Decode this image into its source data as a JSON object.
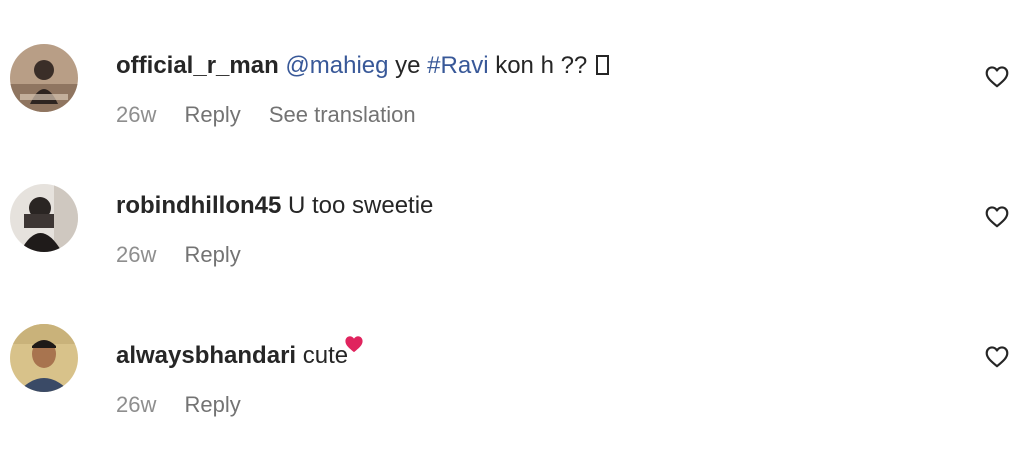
{
  "comments": [
    {
      "username": "official_r_man",
      "mention": "@mahieg",
      "pre_hashtag": " ye ",
      "hashtag": "#Ravi",
      "post_hashtag": " kon h ?? ",
      "timestamp": "26w",
      "reply_label": "Reply",
      "translation_label": "See translation",
      "avatar_icon": "avatar-photo",
      "like_icon": "heart-outline-icon"
    },
    {
      "username": "robindhillon45",
      "text": " U too sweetie",
      "timestamp": "26w",
      "reply_label": "Reply",
      "avatar_icon": "avatar-photo",
      "like_icon": "heart-outline-icon"
    },
    {
      "username": "alwaysbhandari",
      "text": " cute",
      "emoji": "red-heart",
      "timestamp": "26w",
      "reply_label": "Reply",
      "avatar_icon": "avatar-photo",
      "like_icon": "heart-outline-icon"
    }
  ],
  "colors": {
    "text": "#262626",
    "link": "#385898",
    "meta": "#8e8e8e",
    "heart_red": "#e0245e"
  }
}
